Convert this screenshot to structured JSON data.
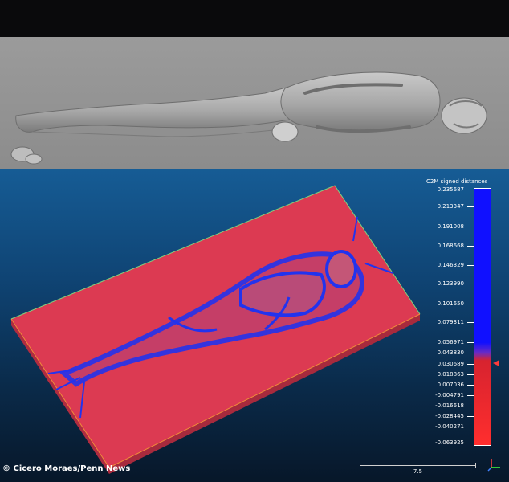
{
  "colors": {
    "relief_background": "#8f8f8f",
    "viewport_top": "#165c95",
    "viewport_bottom": "#071729",
    "slab_red": "#dc3a52",
    "deviation_blue": "#1a2cf0",
    "box_outline": "#7ed37e"
  },
  "panels": {
    "relief": {
      "content": "relief-model-image"
    },
    "viewport": {
      "content": "3d-scan-comparison-view"
    }
  },
  "colorbar": {
    "title": "C2M signed distances",
    "ticks": [
      "0.235687",
      "0.213347",
      "0.191008",
      "0.168668",
      "0.146329",
      "0.123990",
      "0.101650",
      "0.079311",
      "0.056971",
      "0.043830",
      "0.030689",
      "0.018863",
      "0.007036",
      "-0.004791",
      "-0.016618",
      "-0.028445",
      "-0.040271",
      "-0.063925"
    ]
  },
  "credit": "© Cicero Moraes/Penn News",
  "scale_bar": {
    "label": "7.5"
  }
}
